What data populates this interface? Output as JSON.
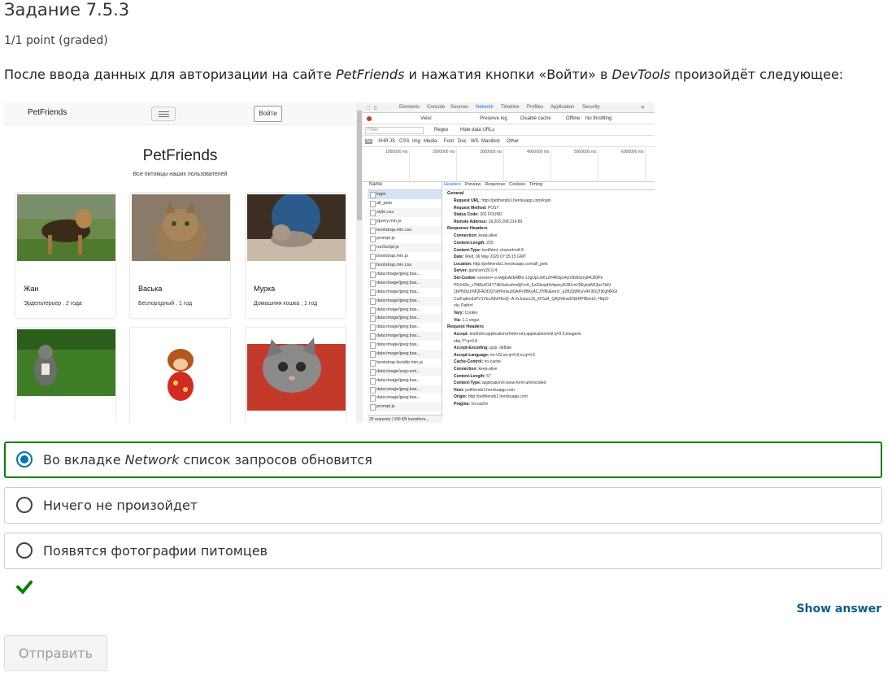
{
  "task": {
    "title": "Задание 7.5.3",
    "points": "1/1 point (graded)",
    "question_prefix": "После ввода данных для авторизации на сайте ",
    "question_site": "PetFriends",
    "question_mid": " и нажатия кнопки «Войти» в ",
    "question_tool": "DevTools",
    "question_suffix": " произойдёт следующее:"
  },
  "screenshot": {
    "brand": "PetFriends",
    "login_button": "Войти",
    "site_title": "PetFriends",
    "site_subtitle": "Все питомцы наших пользователей",
    "pets": [
      {
        "name": "Жан",
        "desc": "Эрдельтерьер , 2 года"
      },
      {
        "name": "Васька",
        "desc": "Беспородный , 1 год"
      },
      {
        "name": "Мурка",
        "desc": "Домашняя кошка , 1 год"
      }
    ],
    "devtools": {
      "tabs": [
        "Elements",
        "Console",
        "Sources",
        "Network",
        "Timeline",
        "Profiles",
        "Application",
        "Security"
      ],
      "active_tab": "Network",
      "toolbar": {
        "view": "View:",
        "preserve_log": "Preserve log",
        "disable_cache": "Disable cache",
        "offline": "Offline",
        "throttling": "No throttling"
      },
      "filter": {
        "placeholder": "Filter",
        "regex": "Regex",
        "hide_data_urls": "Hide data URLs"
      },
      "types": [
        "All",
        "XHR",
        "JS",
        "CSS",
        "Img",
        "Media",
        "Font",
        "Doc",
        "WS",
        "Manifest",
        "Other"
      ],
      "timeline_labels": [
        "1000000 ms",
        "2000000 ms",
        "3000000 ms",
        "4000000 ms",
        "5000000 ms",
        "6000000 ms"
      ],
      "name_header": "Name",
      "requests": [
        "login",
        "all_pets",
        "style.css",
        "jquery.min.js",
        "bootstrap.min.css",
        "prompt.js",
        "runScript.js",
        "bootstrap.min.js",
        "bootstrap.min.css",
        "data:image/jpeg;bas...",
        "data:image/jpeg;bas...",
        "data:image/jpeg;bas...",
        "data:image/jpeg;bas...",
        "data:image/jpeg;bas...",
        "data:image/jpeg;bas...",
        "data:image/jpeg;bas...",
        "data:image/jpeg;bas...",
        "data:image/jpeg;bas...",
        "data:image/jpeg;bas...",
        "bootstrap.bundle.min.js",
        "data:image/svg+xml...",
        "data:image/jpeg;bas...",
        "data:image/jpeg;bas...",
        "data:image/jpeg;bas...",
        "prompt.js"
      ],
      "requests_footer": "25 requests | 330 KB transferre...",
      "detail_tabs": [
        "Headers",
        "Preview",
        "Response",
        "Cookies",
        "Timing"
      ],
      "general_title": "General",
      "general": [
        "Request URL: http://petfriends1.herokuapp.com/login",
        "Request Method: POST",
        "Status Code: 302 FOUND",
        "Remote Address: 18.203.208.214:80"
      ],
      "response_title": "Response Headers",
      "view_source": "view source",
      "response": [
        "Connection: keep-alive",
        "Content-Length: 225",
        "Content-Type: text/html; charset=utf-8",
        "Date: Wed, 06 May 2020 07:35:15 GMT",
        "Location: http://petfriends1.herokuapp.com/all_pets",
        "Server: gunicorn/20.0.4",
        "Set-Cookie: session=.eJwljjtuAzEMBe-12gUpLinK1zH4Rdyu4yrI3bNGmjd4U83Pe",
        "PRJr69x_c7fdRuP24774E0wIcehm6jFrvA_Ez53evjd3vhpmyI5381mV56ykaW53pxTkiN",
        "1bPNDpJrMQFADDQ7aHFmxu9SAIFr9BKyACJYfBuEiercr_a2BZpWKaV4F35QTjKg5fRGt",
        "CuIFqdim3oFV1VkvJ0fsHKoQ--A.XrJosw.US_KF5a4_QAyNlmwDSERPIBexUI; HttpO",
        "nly; Path=/",
        "Vary: Cookie",
        "Via: 1.1 vegur"
      ],
      "request_title": "Request Headers",
      "request": [
        "Accept: text/html,application/xhtml+xml,application/xml;q=0.9,image/w",
        "ebp,*/*;q=0.8",
        "Accept-Encoding: gzip, deflate",
        "Accept-Language: en-US,en;q=0.8,ru;q=0.6",
        "Cache-Control: no-cache",
        "Connection: keep-alive",
        "Content-Length: 57",
        "Content-Type: application/x-www-form-urlencoded",
        "Host: petfriends1.herokuapp.com",
        "Origin: http://petfriends1.herokuapp.com",
        "Pragma: no-cache"
      ]
    }
  },
  "options": [
    {
      "prefix": "Во вкладке ",
      "em": "Network",
      "suffix": " список запросов обновится",
      "selected": true
    },
    {
      "prefix": "Ничего не произойдет",
      "em": "",
      "suffix": "",
      "selected": false
    },
    {
      "prefix": "Появятся фотографии питомцев",
      "em": "",
      "suffix": "",
      "selected": false
    }
  ],
  "show_answer": "Show answer",
  "submit": "Отправить",
  "colors": {
    "correct": "#008100",
    "radio_selected": "#0075b4",
    "link": "#0a5f8c"
  }
}
